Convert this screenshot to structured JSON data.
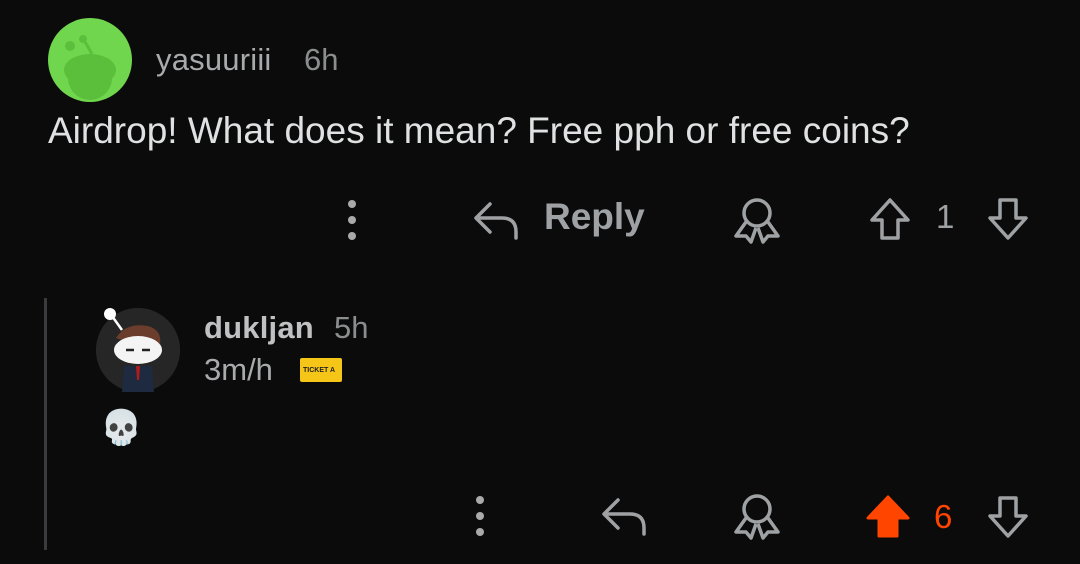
{
  "comment": {
    "username": "yasuuriii",
    "time": "6h",
    "text": "Airdrop! What does it mean? Free pph or free coins?",
    "reply_label": "Reply",
    "vote_count": "1"
  },
  "reply": {
    "username": "dukljan",
    "time": "5h",
    "flair": "3m/h",
    "flair_badge": "TICKET A",
    "body": "💀",
    "vote_count": "6"
  },
  "colors": {
    "background": "#0b0b0b",
    "upvoted": "#ff4500",
    "avatar_green": "#6fd64d",
    "icon_gray": "#9fa2a4"
  },
  "icons": [
    "more-icon",
    "reply-icon",
    "award-icon",
    "upvote-icon",
    "downvote-icon"
  ]
}
